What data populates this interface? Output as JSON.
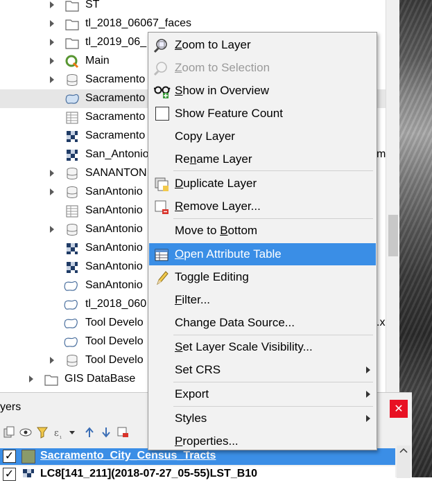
{
  "browser": {
    "items": [
      {
        "label": "ST",
        "icon": "folder-icon",
        "arrow": true
      },
      {
        "label": "tl_2018_06067_faces",
        "icon": "folder-icon",
        "arrow": true
      },
      {
        "label": "tl_2019_06_",
        "icon": "folder-icon",
        "arrow": true
      },
      {
        "label": "Main",
        "icon": "qgis-icon",
        "arrow": true
      },
      {
        "label": "Sacramento",
        "icon": "database-icon",
        "arrow": true
      },
      {
        "label": "Sacramento",
        "icon": "polygon-layer-icon",
        "arrow": false
      },
      {
        "label": "Sacramento",
        "icon": "table-icon",
        "arrow": false
      },
      {
        "label": "Sacramento",
        "icon": "raster-icon",
        "arrow": false
      },
      {
        "label": "San_Antonio",
        "icon": "raster-icon",
        "arrow": false,
        "tail": "m"
      },
      {
        "label": "SANANTON",
        "icon": "database-icon",
        "arrow": true
      },
      {
        "label": "SanAntonio",
        "icon": "database-icon",
        "arrow": true
      },
      {
        "label": "SanAntonio",
        "icon": "table-icon",
        "arrow": false
      },
      {
        "label": "SanAntonio",
        "icon": "database-icon",
        "arrow": true
      },
      {
        "label": "SanAntonio",
        "icon": "raster-icon",
        "arrow": false
      },
      {
        "label": "SanAntonio",
        "icon": "raster-icon",
        "arrow": false
      },
      {
        "label": "SanAntonio",
        "icon": "polygon-layer-icon",
        "arrow": false
      },
      {
        "label": "tl_2018_060",
        "icon": "polygon-layer-icon",
        "arrow": false
      },
      {
        "label": "Tool Develo",
        "icon": "polygon-layer-icon",
        "arrow": false,
        "tail": ".xl"
      },
      {
        "label": "Tool Develo",
        "icon": "polygon-layer-icon",
        "arrow": false
      },
      {
        "label": "Tool Develo",
        "icon": "database-icon",
        "arrow": true
      }
    ],
    "root_item": {
      "label": "GIS DataBase",
      "icon": "folder-icon"
    }
  },
  "layers_panel": {
    "title": "yers",
    "close_label": "✕",
    "layer_1": {
      "name": "Sacramento_City_Census_Tracts",
      "checked": "✓"
    },
    "layer_2": {
      "name": "LC8[141_211](2018-07-27_05-55)LST_B10",
      "checked": "✓"
    }
  },
  "context_menu": {
    "items": [
      {
        "pre": "",
        "u": "Z",
        "post": "oom to Layer",
        "icon": "zoom-layer-icon",
        "disabled": false
      },
      {
        "pre": "",
        "u": "Z",
        "post": "oom to Selection",
        "icon": "zoom-selection-icon",
        "disabled": true
      },
      {
        "pre": "",
        "u": "S",
        "post": "how in Overview",
        "icon": "glasses-icon",
        "disabled": false
      },
      {
        "pre": "Show Feature Count",
        "u": "",
        "post": "",
        "icon": "checkbox-icon",
        "disabled": false
      },
      {
        "pre": "Copy Layer",
        "u": "",
        "post": "",
        "icon": "",
        "disabled": false
      },
      {
        "pre": "Re",
        "u": "n",
        "post": "ame Layer",
        "icon": "",
        "disabled": false
      },
      {
        "pre": "",
        "u": "D",
        "post": "uplicate Layer",
        "icon": "duplicate-layer-icon",
        "disabled": false
      },
      {
        "pre": "",
        "u": "R",
        "post": "emove Layer...",
        "icon": "remove-layer-icon",
        "disabled": false
      },
      {
        "pre": "Move to ",
        "u": "B",
        "post": "ottom",
        "icon": "",
        "disabled": false
      },
      {
        "pre": "",
        "u": "O",
        "post": "pen Attribute Table",
        "icon": "attribute-table-icon",
        "disabled": false,
        "selected": true
      },
      {
        "pre": "Toggle Editing",
        "u": "",
        "post": "",
        "icon": "pencil-icon",
        "disabled": false
      },
      {
        "pre": "",
        "u": "F",
        "post": "ilter...",
        "icon": "",
        "disabled": false
      },
      {
        "pre": "Change Data Source...",
        "u": "",
        "post": "",
        "icon": "",
        "disabled": false
      },
      {
        "pre": "",
        "u": "S",
        "post": "et Layer Scale Visibility...",
        "icon": "",
        "disabled": false
      },
      {
        "pre": "Set CRS",
        "u": "",
        "post": "",
        "icon": "",
        "disabled": false,
        "submenu": true
      },
      {
        "pre": "Export",
        "u": "",
        "post": "",
        "icon": "",
        "disabled": false,
        "submenu": true
      },
      {
        "pre": "Styles",
        "u": "",
        "post": "",
        "icon": "",
        "disabled": false,
        "submenu": true
      },
      {
        "pre": "",
        "u": "P",
        "post": "roperties...",
        "icon": "",
        "disabled": false
      }
    ]
  },
  "colors": {
    "selection": "#3a8ee6",
    "close": "#e81123"
  }
}
